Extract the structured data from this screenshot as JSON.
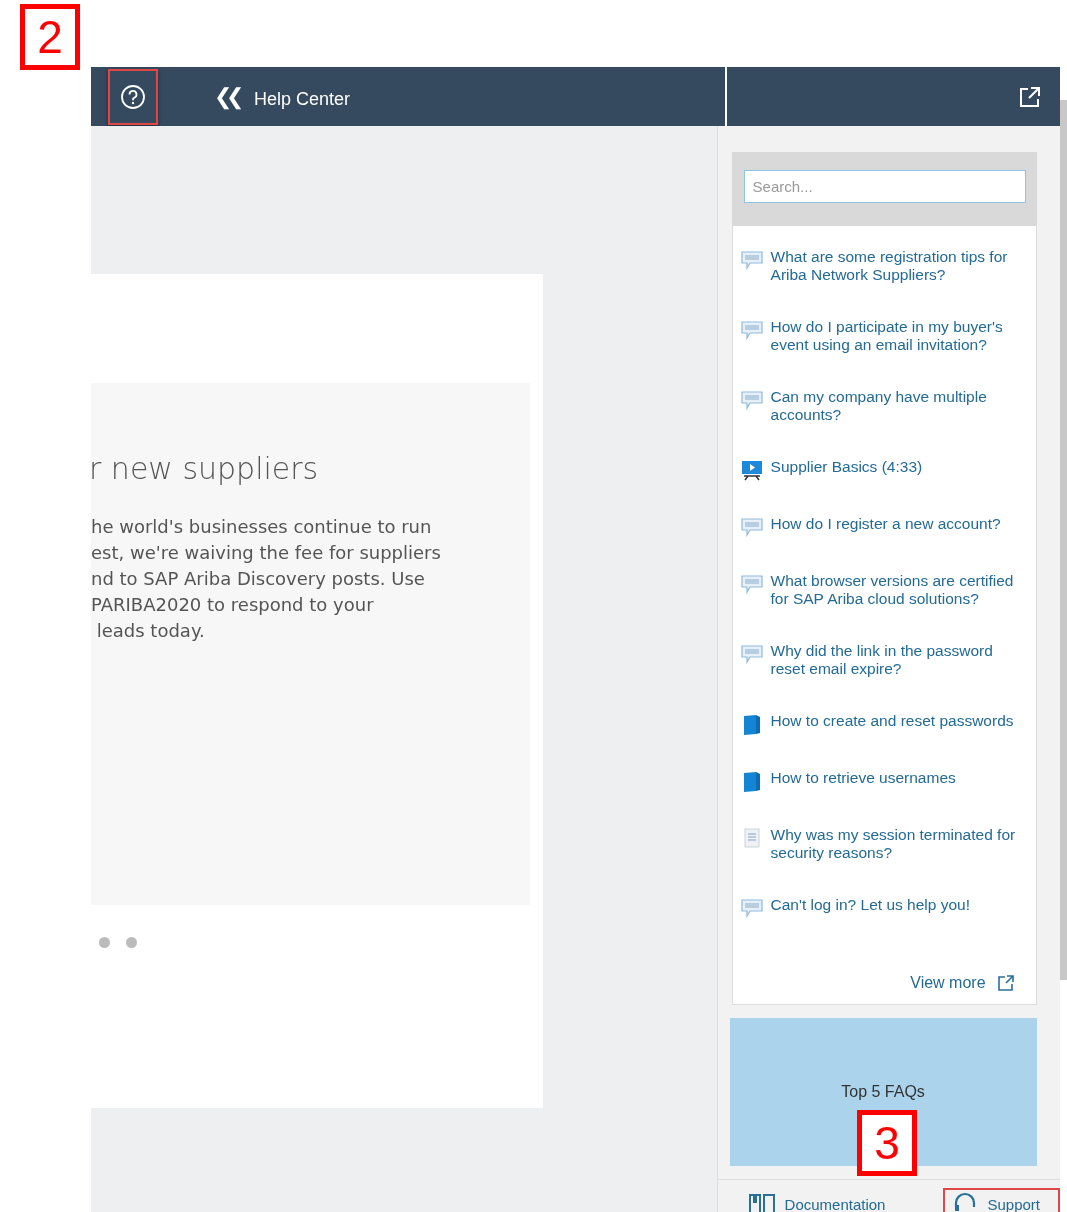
{
  "annotations": [
    {
      "label": "2"
    },
    {
      "label": "3"
    }
  ],
  "header": {
    "help_button": {
      "highlighted": true
    },
    "back_icon": "❮❮",
    "title": "Help Center"
  },
  "main": {
    "heading": "r new suppliers",
    "body_lines": [
      "he world's businesses continue to run",
      "est, we're waiving the fee for suppliers",
      "nd to SAP Ariba Discovery posts. Use",
      "PARIBA2020 to respond to your",
      " leads today."
    ],
    "carousel_dots": [
      {
        "selected": false
      },
      {
        "selected": false
      }
    ]
  },
  "help_panel": {
    "search": {
      "placeholder": "Search..."
    },
    "items": [
      {
        "kind": "faq",
        "text": "What are some registration tips for Ariba Network Suppliers?"
      },
      {
        "kind": "faq",
        "text": "How do I participate in my buyer's event using an email invitation?"
      },
      {
        "kind": "faq",
        "text": "Can my company have multiple accounts?"
      },
      {
        "kind": "video",
        "text": "Supplier Basics (4:33)"
      },
      {
        "kind": "faq",
        "text": "How do I register a new account?"
      },
      {
        "kind": "faq",
        "text": "What browser versions are certified for SAP Ariba cloud solutions?"
      },
      {
        "kind": "faq",
        "text": "Why did the link in the password reset email expire?"
      },
      {
        "kind": "guide",
        "text": "How to create and reset passwords"
      },
      {
        "kind": "guide",
        "text": "How to retrieve usernames"
      },
      {
        "kind": "document",
        "text": "Why was my session terminated for security reasons?"
      },
      {
        "kind": "faq",
        "text": "Can't log in? Let us help you!"
      }
    ],
    "view_more": "View more",
    "tile": "Top 5 FAQs",
    "footer": [
      {
        "kind": "documentation",
        "label": "Documentation",
        "highlighted": false
      },
      {
        "kind": "support",
        "label": "Support",
        "highlighted": true
      }
    ]
  }
}
